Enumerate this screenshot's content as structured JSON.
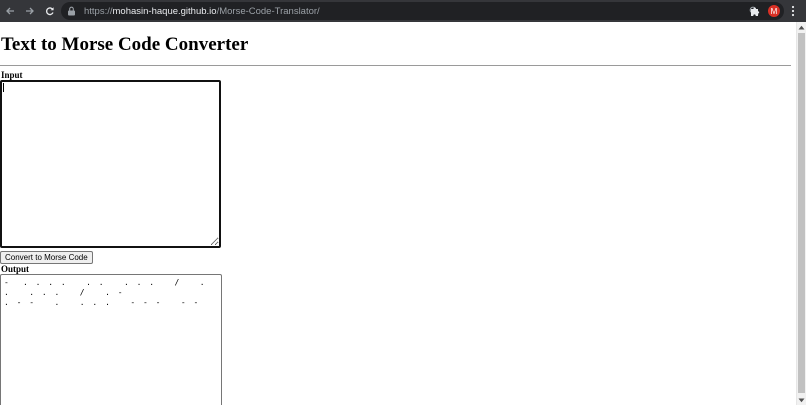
{
  "browser": {
    "url_scheme": "https://",
    "url_host": "mohasin-haque.github.io",
    "url_path": "/Morse-Code-Translator/",
    "profile_initial": "M",
    "icons": {
      "back": "arrow-left",
      "forward": "arrow-right",
      "reload": "reload",
      "lock": "lock",
      "zoom": "magnifier",
      "bookmark": "star",
      "extensions": "puzzle-piece",
      "menu": "three-dots-vertical"
    },
    "colors": {
      "toolbar": "#35363a",
      "omnibox": "#202124",
      "avatar": "#d93025"
    }
  },
  "page": {
    "title": "Text to Morse Code Converter",
    "input_label": "Input",
    "input_value": "",
    "button_label": "Convert to Morse Code",
    "output_label": "Output",
    "output_value": "-  . . . .   . .   . . .   /   . .   . . .   /   . -\n. - -   .   . . .   - - -   - -"
  }
}
